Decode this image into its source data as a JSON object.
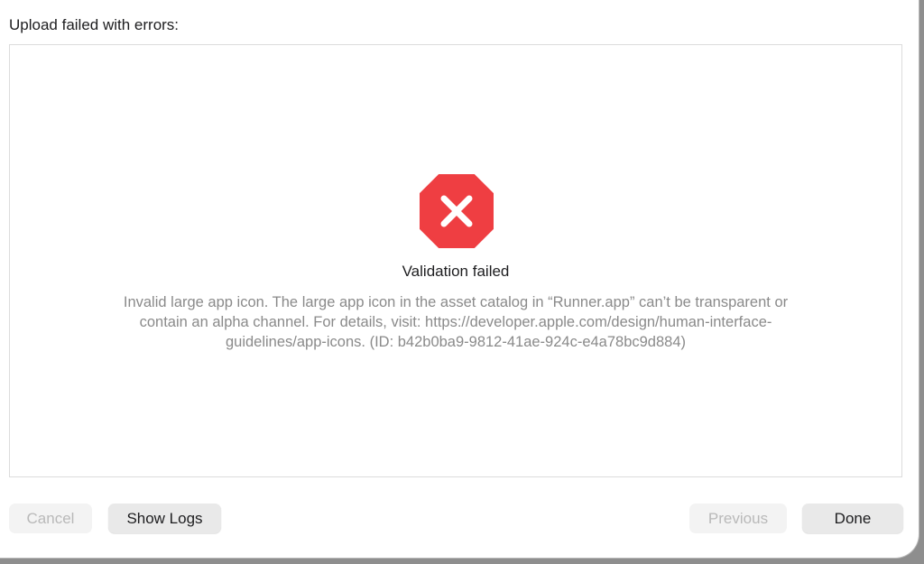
{
  "header": {
    "title": "Upload failed with errors:"
  },
  "message": {
    "icon": "error-octagon-icon",
    "icon_color": "#ef3e42",
    "title": "Validation failed",
    "lines": [
      "Invalid large app icon. The large app icon in the asset catalog in “Runner.app” can’t be transparent or",
      "contain an alpha channel. For details, visit: https://developer.apple.com/design/human-interface-",
      "guidelines/app-icons. (ID: b42b0ba9-9812-41ae-924c-e4a78bc9d884)"
    ]
  },
  "footer": {
    "cancel_label": "Cancel",
    "show_logs_label": "Show Logs",
    "previous_label": "Previous",
    "done_label": "Done"
  }
}
